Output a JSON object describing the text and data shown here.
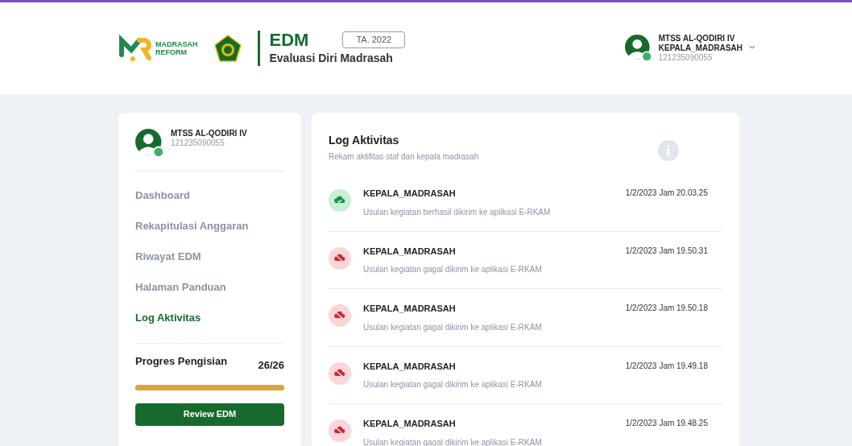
{
  "header": {
    "logo_text": [
      "MADRASAH",
      "REFORM"
    ],
    "app_name": "EDM",
    "year_badge": "TA. 2022",
    "app_subtitle": "Evaluasi Diri Madrasah",
    "user": {
      "name": "MTSS AL-QODIRI IV",
      "role": "KEPALA_MADRASAH",
      "id": "121235090055"
    }
  },
  "sidebar": {
    "profile": {
      "name": "MTSS AL-QODIRI IV",
      "id": "121235090055"
    },
    "items": [
      {
        "label": "Dashboard",
        "selected": false
      },
      {
        "label": "Rekapitulasi Anggaran",
        "selected": false
      },
      {
        "label": "Riwayat EDM",
        "selected": false
      },
      {
        "label": "Halaman Panduan",
        "selected": false
      },
      {
        "label": "Log Aktivitas",
        "selected": true
      }
    ],
    "progress": {
      "label": "Progres Pengisian",
      "count": "26/26",
      "level": 1
    },
    "button": "Review EDM"
  },
  "log": {
    "title": "Log Aktivitas",
    "subtitle": "Rekam aktifitas staf dan kepala madrasah",
    "entries": [
      {
        "kind": "success",
        "user": "KEPALA_MADRASAH",
        "message": "Usulan kegiatan berhasil dikirim ke aplikasi E-RKAM",
        "time": "1/2/2023 Jam 20.03.25"
      },
      {
        "kind": "failed",
        "user": "KEPALA_MADRASAH",
        "message": "Usulan kegiatan gagal dikirim ke aplikasi E-RKAM",
        "time": "1/2/2023 Jam 19.50.31"
      },
      {
        "kind": "failed",
        "user": "KEPALA_MADRASAH",
        "message": "Usulan kegiatan gagal dikirim ke aplikasi E-RKAM",
        "time": "1/2/2023 Jam 19.50.18"
      },
      {
        "kind": "failed",
        "user": "KEPALA_MADRASAH",
        "message": "Usulan kegiatan gagal dikirim ke aplikasi E-RKAM",
        "time": "1/2/2023 Jam 19.49.18"
      },
      {
        "kind": "failed",
        "user": "KEPALA_MADRASAH",
        "message": "Usulan kegiatan gagal dikirim ke aplikasi E-RKAM",
        "time": "1/2/2023 Jam 19.48.25"
      }
    ]
  }
}
